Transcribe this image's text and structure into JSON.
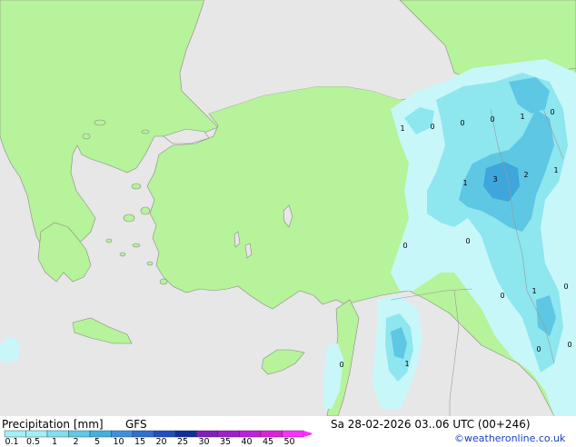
{
  "title_left": "Precipitation [mm]",
  "model": "GFS",
  "datetime": "Sa 28-02-2026 03..06 UTC (00+246)",
  "credit": "©weatheronline.co.uk",
  "legend": {
    "labels": [
      "0.1",
      "0.5",
      "1",
      "2",
      "5",
      "10",
      "15",
      "20",
      "25",
      "30",
      "35",
      "40",
      "45",
      "50"
    ],
    "colors": [
      "#a0f0f8",
      "#a0f0f8",
      "#80e0f0",
      "#60c8e8",
      "#40b0e0",
      "#3f8fdc",
      "#2f6fd0",
      "#1f4fc0",
      "#0f2fa0",
      "#7f1fbf",
      "#9f1fcf",
      "#bf1fdf",
      "#df1fdf",
      "#ff30ff"
    ]
  },
  "contour_labels": [
    {
      "text": "1"
    },
    {
      "text": "0"
    },
    {
      "text": "0"
    },
    {
      "text": "0"
    },
    {
      "text": "1"
    },
    {
      "text": "0"
    },
    {
      "text": "1"
    },
    {
      "text": "3"
    },
    {
      "text": "2"
    },
    {
      "text": "1"
    },
    {
      "text": "0"
    },
    {
      "text": "0"
    },
    {
      "text": "0"
    },
    {
      "text": "1"
    },
    {
      "text": "0"
    },
    {
      "text": "0"
    },
    {
      "text": "0"
    },
    {
      "text": "0"
    },
    {
      "text": "1"
    }
  ],
  "colors": {
    "land": "#b6f39a",
    "sea": "#e7e7e7",
    "precip_light": "#c8f7f9",
    "precip_medium": "#8ee6ef",
    "precip_heavy": "#5ec7e3",
    "precip_max": "#3fa6dc"
  }
}
